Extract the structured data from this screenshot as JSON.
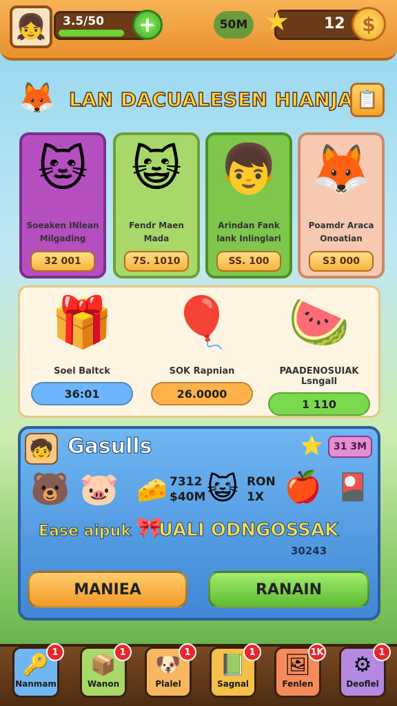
{
  "header": {
    "xp_text": "3.5/50",
    "plus_label": "+",
    "timer": "50M",
    "stars": "12",
    "coin_symbol": "$"
  },
  "title": {
    "text": "LAN DACUALESEN HIANJAN"
  },
  "characters": [
    {
      "name": "Soeaken INlean Milgading",
      "price": "32 001",
      "bg": "#b54fc0",
      "border": "#7a2f8a",
      "icon": "cat"
    },
    {
      "name": "Fendr Maen Mada",
      "price": "7S. 1010",
      "bg": "#a9d86a",
      "border": "#6e9e3a",
      "icon": "purple-cat"
    },
    {
      "name": "Arindan Fank lank Inlinglari",
      "price": "SS. 100",
      "bg": "#7ec64c",
      "border": "#4e8f2a",
      "icon": "boy"
    },
    {
      "name": "Poamdr Araca Onoatian",
      "price": "S3 000",
      "bg": "#f6c9b0",
      "border": "#c98a6a",
      "icon": "fox"
    }
  ],
  "items": [
    {
      "name": "Soel Baltck",
      "button": "36:01",
      "btn_color": "#6bb6ff",
      "icon": "gift"
    },
    {
      "name": "SOK Rapnian",
      "button": "26.0000",
      "btn_color": "#ffb14a",
      "icon": "balloons"
    },
    {
      "name": "PAADENOSUIAK Lsngall",
      "button": "1 110",
      "btn_color": "#7bd94e",
      "icon": "fruit"
    }
  ],
  "goals": {
    "title": "Gasulls",
    "badge": "31 3M",
    "val1_a": "7312",
    "val1_b": "$40M",
    "val2_a": "RON",
    "val2_b": "1X",
    "ease": "Ease aipuk",
    "unlock": "UALI ODNGOSSAK",
    "sub": "30243",
    "btn_left": "MANIEA",
    "btn_right": "RANAIN"
  },
  "nav": [
    {
      "label": "Nanmam",
      "badge": "1",
      "color": "#6fb6f2",
      "icon": "key-icon"
    },
    {
      "label": "Wanon",
      "badge": "1",
      "color": "#a9d86a",
      "icon": "chest-icon"
    },
    {
      "label": "Plalel",
      "badge": "1",
      "color": "#f5b860",
      "icon": "pet-icon"
    },
    {
      "label": "Sagnal",
      "badge": "1",
      "color": "#f5c04a",
      "icon": "book-icon"
    },
    {
      "label": "Fenlen",
      "badge": "1K",
      "color": "#f58a5a",
      "icon": "photo-icon"
    },
    {
      "label": "Deoflel",
      "badge": "1",
      "color": "#b48ae0",
      "icon": "gear-icon"
    }
  ]
}
